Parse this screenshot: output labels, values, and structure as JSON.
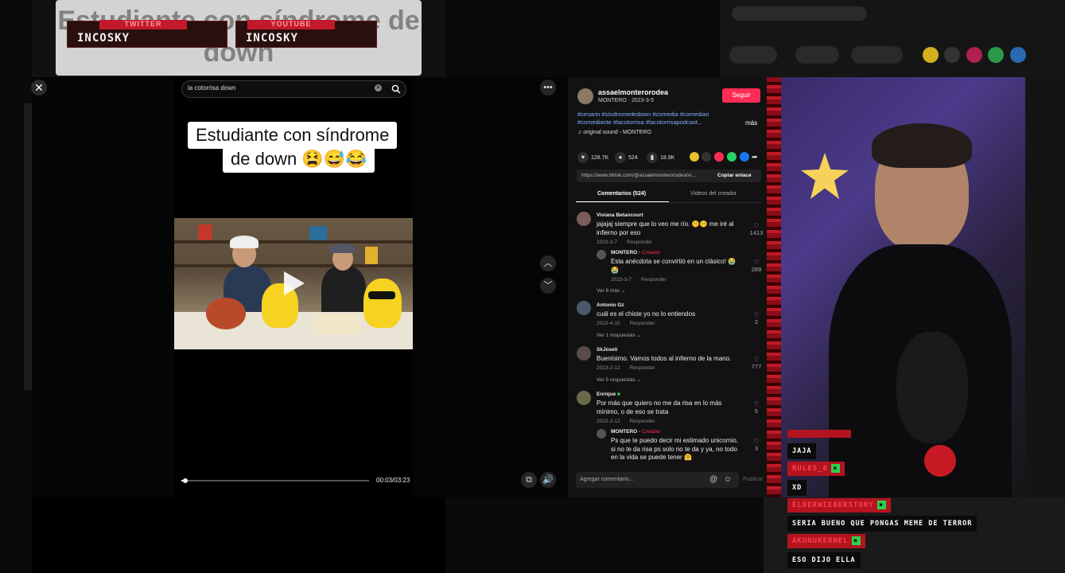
{
  "background": {
    "blurred_title": "Estudiante con síndrome de down",
    "social": [
      {
        "platform": "TWITTER",
        "handle": "INCOSKY"
      },
      {
        "platform": "YOUTUBE",
        "handle": "INCOSKY"
      }
    ]
  },
  "player": {
    "search_query": "la cotorrisa down",
    "caption_line1": "Estudiante con síndrome",
    "caption_line2": "de down 😫😅😂",
    "time": "00:03/03:23",
    "progress_fraction": 0.015
  },
  "post": {
    "username": "assaelmonterorodea",
    "meta": "MONTERO · 2023-3-5",
    "follow_label": "Seguir",
    "hashtags": "#cesarin #síndromededown #comedia #comedian #comediante #lacotorrisa #lacotorrisapodcast...",
    "more_label": "más",
    "sound": "original sound - MONTERO",
    "likes": "128.7K",
    "comments": "524",
    "saves": "18.9K",
    "link": "https://www.tiktok.com/@assaelmonterorodea/vi...",
    "copy_link_label": "Copiar enlace",
    "tab_comments": "Comentarios (524)",
    "tab_creator": "Videos del creador"
  },
  "comments": [
    {
      "name": "Viviana Betancourt",
      "text": "jajajaj siempre que lo veo me río. 🤫🤫 me iré al infierno por eso",
      "date": "2023-3-7",
      "reply": "Responder",
      "likes": "1413"
    },
    {
      "name": "MONTERO",
      "creator_tag": "Creador",
      "text": "Esta anécdota se convirtió en un clásico! 😭😭",
      "date": "2023-3-7",
      "reply": "Responder",
      "likes": "289",
      "more": "Ver 8 más ⌄"
    },
    {
      "name": "Antonio Gz",
      "text": "cuál es el chiste yo no lo entiendos",
      "date": "2023-4-15",
      "reply": "Responder",
      "likes": "2",
      "more": "Ver 1 respuestas ⌄"
    },
    {
      "name": "SkJoseli",
      "text": "Buenísimo. Vamos todos al infierno de la mano.",
      "date": "2023-3-12",
      "reply": "Responder",
      "likes": "777",
      "more": "Ver 5 respuestas ⌄"
    },
    {
      "name": "Enrique",
      "text": "Por más que quiero no me da risa en lo más mínimo, o de eso se trata",
      "date": "2023-3-12",
      "reply": "Responder",
      "likes": "5"
    },
    {
      "name": "MONTERO",
      "creator_tag": "Creador",
      "text": "Ps que te puedo decir mi estimado unicornio, si no te da risa ps solo no te da y ya, no todo en la vida se puede tener 🤗",
      "likes": "3"
    }
  ],
  "comment_input": {
    "placeholder": "Agregar comentario...",
    "publish": "Publicar"
  },
  "chat": [
    {
      "type": "msg",
      "text": "JAJA"
    },
    {
      "type": "name",
      "text": "RULES_0"
    },
    {
      "type": "msg",
      "text": "XD"
    },
    {
      "type": "name",
      "text": "ELBERWIEBERSTORY"
    },
    {
      "type": "msg",
      "text": "SERIA BUENO QUE PONGAS MEME DE TERROR"
    },
    {
      "type": "name",
      "text": "AKUNUKERNEL"
    },
    {
      "type": "msg",
      "text": "ESO DIJO ELLA"
    }
  ],
  "colors": {
    "accent": "#fe2c55",
    "link": "#7db0ff",
    "chat_red": "#b3141f",
    "mod_green": "#2bd04a"
  }
}
